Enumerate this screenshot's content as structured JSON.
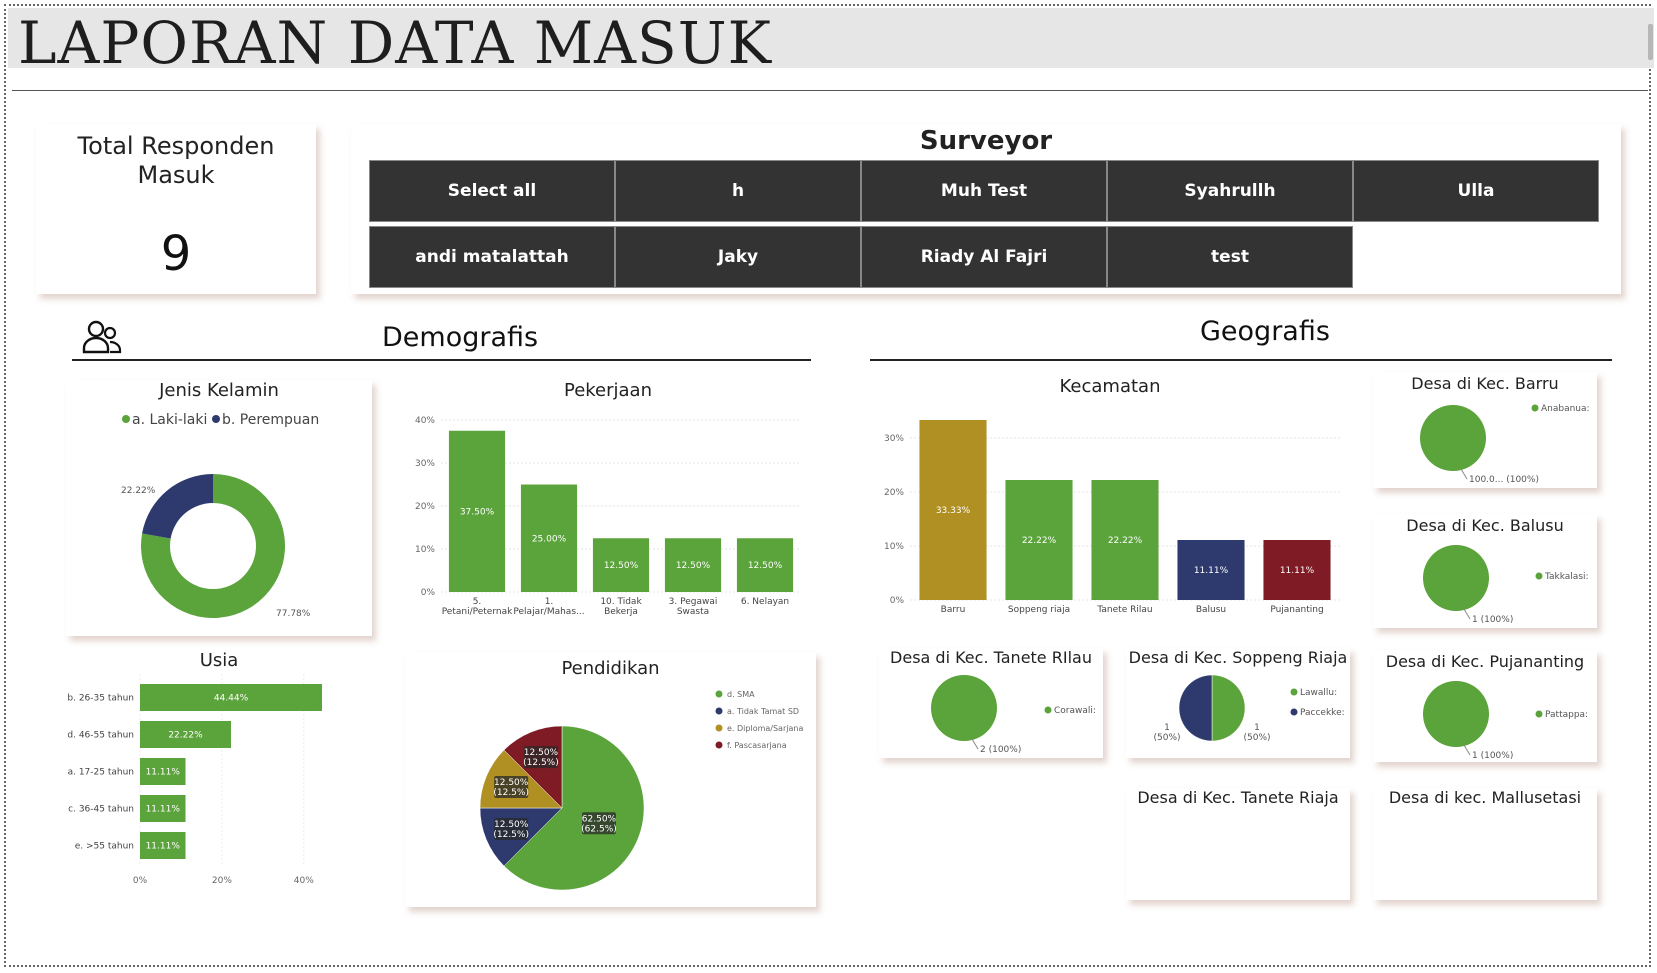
{
  "report": {
    "title": "LAPORAN DATA MASUK"
  },
  "kpi": {
    "label": "Total Responden Masuk",
    "value": "9"
  },
  "surveyor": {
    "title": "Surveyor",
    "options": [
      "Select all",
      "h",
      "Muh Test",
      "Syahrullh",
      "Ulla",
      "andi matalattah",
      "Jaky",
      "Riady Al Fajri",
      "test"
    ]
  },
  "sections": {
    "demografis": "Demografis",
    "geografis": "Geografis"
  },
  "icons": {
    "demografis": "people-group-icon"
  },
  "colors": {
    "green": "#5ba33b",
    "navy": "#2e3a6e",
    "gold": "#b09022",
    "maroon": "#7e1b24",
    "tile": "#333333"
  },
  "chart_data": [
    {
      "id": "jenis_kelamin",
      "type": "donut",
      "title": "Jenis Kelamin",
      "categories": [
        "a. Laki-laki",
        "b. Perempuan"
      ],
      "values": [
        77.78,
        22.22
      ],
      "labels": [
        "77.78%",
        "22.22%"
      ],
      "legend": "top"
    },
    {
      "id": "pekerjaan",
      "type": "bar",
      "title": "Pekerjaan",
      "categories": [
        "5. Petani/Peternak",
        "1. Pelajar/Mahas...",
        "10. Tidak Bekerja",
        "3. Pegawai Swasta",
        "6. Nelayan"
      ],
      "values": [
        37.5,
        25.0,
        12.5,
        12.5,
        12.5
      ],
      "labels": [
        "37.50%",
        "25.00%",
        "12.50%",
        "12.50%",
        "12.50%"
      ],
      "ylim": [
        0,
        40
      ],
      "yticks": [
        "0%",
        "10%",
        "20%",
        "30%",
        "40%"
      ],
      "grid": true
    },
    {
      "id": "usia",
      "type": "bar",
      "orientation": "horizontal",
      "title": "Usia",
      "categories": [
        "b. 26-35 tahun",
        "d. 46-55 tahun",
        "a. 17-25 tahun",
        "c. 36-45 tahun",
        "e. >55 tahun"
      ],
      "values": [
        44.44,
        22.22,
        11.11,
        11.11,
        11.11
      ],
      "labels": [
        "44.44%",
        "22.22%",
        "11.11%",
        "11.11%",
        "11.11%"
      ],
      "xlim": [
        0,
        44.44
      ],
      "xticks": [
        "0%",
        "20%",
        "40%"
      ]
    },
    {
      "id": "pendidikan",
      "type": "pie",
      "title": "Pendidikan",
      "categories": [
        "d. SMA",
        "a. Tidak Tamat SD",
        "e. Diploma/Sarjana",
        "f. Pascasarjana"
      ],
      "values": [
        62.5,
        12.5,
        12.5,
        12.5
      ],
      "labels": [
        "62.50% (62.5%)",
        "12.50% (12.5%)",
        "12.50% (12.5%)",
        "12.50% (12.5%)"
      ],
      "legend": "top-right"
    },
    {
      "id": "kecamatan",
      "type": "bar",
      "title": "Kecamatan",
      "categories": [
        "Barru",
        "Soppeng riaja",
        "Tanete Rilau",
        "Balusu",
        "Pujananting"
      ],
      "values": [
        33.33,
        22.22,
        22.22,
        11.11,
        11.11
      ],
      "labels": [
        "33.33%",
        "22.22%",
        "22.22%",
        "11.11%",
        "11.11%"
      ],
      "ylim": [
        0,
        33.33
      ],
      "yticks": [
        "0%",
        "10%",
        "20%",
        "30%"
      ],
      "grid": true
    },
    {
      "id": "desa_barru",
      "type": "pie",
      "title": "Desa di Kec. Barru",
      "categories": [
        "Anabanua"
      ],
      "legend_labels": [
        "Anabanua:"
      ],
      "values": [
        1
      ],
      "labels": [
        "100.0... (100%)"
      ]
    },
    {
      "id": "desa_balusu",
      "type": "pie",
      "title": "Desa di Kec. Balusu",
      "categories": [
        "Takkalasi"
      ],
      "legend_labels": [
        "Takkalasi:"
      ],
      "values": [
        1
      ],
      "labels": [
        "1 (100%)"
      ]
    },
    {
      "id": "desa_pujananting",
      "type": "pie",
      "title": "Desa di Kec. Pujananting",
      "categories": [
        "Pattappa"
      ],
      "legend_labels": [
        "Pattappa:"
      ],
      "values": [
        1
      ],
      "labels": [
        "1 (100%)"
      ]
    },
    {
      "id": "desa_tanete_rilau",
      "type": "pie",
      "title": "Desa di Kec. Tanete RIlau",
      "categories": [
        "Corawali"
      ],
      "legend_labels": [
        "Corawali:"
      ],
      "values": [
        2
      ],
      "labels": [
        "2 (100%)"
      ]
    },
    {
      "id": "desa_soppeng_riaja",
      "type": "pie",
      "title": "Desa di Kec. Soppeng Riaja",
      "categories": [
        "Lawallu",
        "Paccekke"
      ],
      "legend_labels": [
        "Lawallu:",
        "Paccekke:"
      ],
      "values": [
        1,
        1
      ],
      "labels": [
        "1 (50%)",
        "1 (50%)"
      ]
    },
    {
      "id": "desa_tanete_riaja",
      "type": "pie",
      "title": "Desa di Kec. Tanete Riaja",
      "categories": [],
      "values": []
    },
    {
      "id": "desa_mallusetasi",
      "type": "pie",
      "title": "Desa di kec. Mallusetasi",
      "categories": [],
      "values": []
    }
  ]
}
